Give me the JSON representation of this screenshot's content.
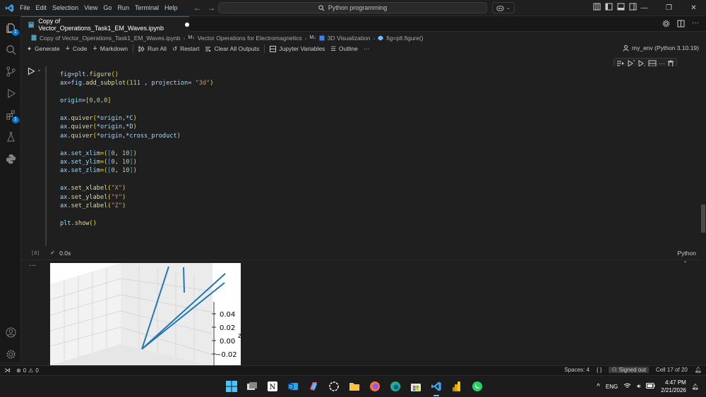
{
  "titlebar": {
    "menu": [
      "File",
      "Edit",
      "Selection",
      "View",
      "Go",
      "Run",
      "Terminal",
      "Help"
    ],
    "search_text": "Python programming"
  },
  "tab": {
    "filename": "Copy of Vector_Operations_Task1_EM_Waves.ipynb"
  },
  "breadcrumb": {
    "file": "Copy of Vector_Operations_Task1_EM_Waves.ipynb",
    "section1": "Vector Operations for Electromagnetics",
    "section2": "3D Visualization",
    "symbol": "fig=plt.figure()"
  },
  "toolbar": {
    "generate": "Generate",
    "code": "Code",
    "markdown": "Markdown",
    "run_all": "Run All",
    "restart": "Restart",
    "clear_outputs": "Clear All Outputs",
    "variables": "Jupyter Variables",
    "outline": "Outline",
    "more": "···",
    "kernel": "my_env (Python 3.10.19)"
  },
  "cell": {
    "exec_count": "[8]",
    "duration": "0.0s",
    "language": "Python",
    "code": {
      "l1_a": "fig",
      "l1_b": "=",
      "l1_c": "plt",
      "l1_d": ".",
      "l1_e": "figure",
      "l1_f": "()",
      "l2_a": "ax",
      "l2_b": "=",
      "l2_c": "fig",
      "l2_d": ".",
      "l2_e": "add_subplot",
      "l2_f": "(",
      "l2_g": "111",
      "l2_h": " , ",
      "l2_i": "projection",
      "l2_j": "= ",
      "l2_k": "\"3d\"",
      "l2_l": ")",
      "l3_a": "origin",
      "l3_b": "=",
      "l3_c": "[",
      "l3_d": "0,0,0",
      "l3_e": "]",
      "q1_a": "ax",
      "q1_b": ".",
      "q1_c": "quiver",
      "q1_d": "(",
      "q1_e": "*origin",
      "q1_f": ",*",
      "q1_g": "C",
      "q1_h": ")",
      "q2_a": "ax",
      "q2_b": ".",
      "q2_c": "quiver",
      "q2_d": "(",
      "q2_e": "*origin",
      "q2_f": ",*",
      "q2_g": "D",
      "q2_h": ")",
      "q3_a": "ax",
      "q3_b": ".",
      "q3_c": "quiver",
      "q3_d": "(",
      "q3_e": "*origin",
      "q3_f": ",*",
      "q3_g": "cross_product",
      "q3_h": ")",
      "x1_a": "ax",
      "x1_b": ".",
      "x1_c": "set_xlim",
      "x1_d": "=(",
      "x1_e": "[",
      "x1_f": "0",
      "x1_g": ", ",
      "x1_h": "10",
      "x1_i": "]",
      "x1_j": ")",
      "y1_a": "ax",
      "y1_b": ".",
      "y1_c": "set_ylim",
      "y1_d": "=(",
      "y1_e": "[",
      "y1_f": "0",
      "y1_g": ", ",
      "y1_h": "10",
      "y1_i": "]",
      "y1_j": ")",
      "z1_a": "ax",
      "z1_b": ".",
      "z1_c": "set_zlim",
      "z1_d": "=(",
      "z1_e": "[",
      "z1_f": "0",
      "z1_g": ", ",
      "z1_h": "10",
      "z1_i": "]",
      "z1_j": ")",
      "xl_a": "ax",
      "xl_b": ".",
      "xl_c": "set_xlabel",
      "xl_d": "(",
      "xl_e": "\"X\"",
      "xl_f": ")",
      "yl_a": "ax",
      "yl_b": ".",
      "yl_c": "set_ylabel",
      "yl_d": "(",
      "yl_e": "\"Y\"",
      "yl_f": ")",
      "zl_a": "ax",
      "zl_b": ".",
      "zl_c": "set_zlabel",
      "zl_d": "(",
      "zl_e": "\"Z\"",
      "zl_f": ")",
      "sh_a": "plt",
      "sh_b": ".",
      "sh_c": "show",
      "sh_d": "()"
    }
  },
  "output": {
    "z_ticks": [
      "0.04",
      "0.02",
      "0.00",
      "−0.02"
    ],
    "z_label_partial": "z"
  },
  "statusbar": {
    "errors": "0",
    "warnings": "0",
    "spaces": "Spaces: 4",
    "braces": "{ }",
    "signed_out": "Signed out",
    "cell_pos": "Cell 17 of 20"
  },
  "taskbar": {
    "lang": "ENG",
    "time": "4:47 PM",
    "date": "2/21/2026"
  },
  "activity_badges": {
    "explorer": "1",
    "extensions": "1"
  },
  "colors": {
    "accent": "#0078d4",
    "quiver": "#1f77b4"
  }
}
